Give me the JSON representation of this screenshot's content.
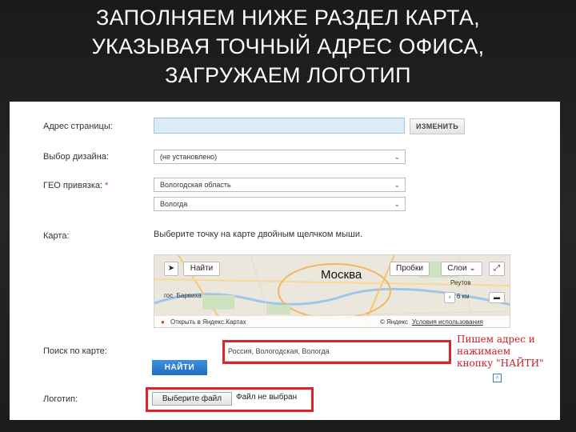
{
  "slide": {
    "title_lines": [
      "ЗАПОЛНЯЕМ НИЖЕ РАЗДЕЛ КАРТА,",
      "УКАЗЫВАЯ ТОЧНЫЙ АДРЕС ОФИСА,",
      "ЗАГРУЖАЕМ ЛОГОТИП"
    ]
  },
  "form": {
    "page_address": {
      "label": "Адрес страницы:",
      "value": "",
      "button": "ИЗМЕНИТЬ"
    },
    "design": {
      "label": "Выбор дизайна:",
      "selected": "(не установлено)"
    },
    "geo": {
      "label": "ГЕО привязка:",
      "required_mark": "*",
      "region": "Вологодская область",
      "city": "Вологда"
    },
    "map": {
      "label": "Карта:",
      "hint": "Выберите точку на карте двойным щелчком мыши.",
      "find_button": "Найти",
      "traffic_button": "Пробки",
      "layers_button": "Слои",
      "city_label": "Москва",
      "place_reutov": "Реутов",
      "place_barvikha": "гос. Барвиха",
      "scale_text": "6 км",
      "open_link": "Открыть в Яндекс.Картах",
      "copyright": "© Яндекс",
      "terms_link": "Условия использования"
    },
    "search": {
      "label": "Поиск по карте:",
      "value": "Россия, Вологодская, Вологда",
      "button": "НАЙТИ"
    },
    "logo": {
      "label": "Логотип:",
      "file_button": "Выберите файл",
      "file_status": "Файл не выбран"
    }
  },
  "annotation": {
    "text_lines": [
      "Пишем адрес и",
      "нажимаем",
      "кнопку \"НАЙТИ\""
    ],
    "color": "#c91e2a"
  },
  "colors": {
    "accent_blue": "#2a7cc9",
    "highlight_red": "#d9262e",
    "input_blue": "#dcecf7"
  }
}
